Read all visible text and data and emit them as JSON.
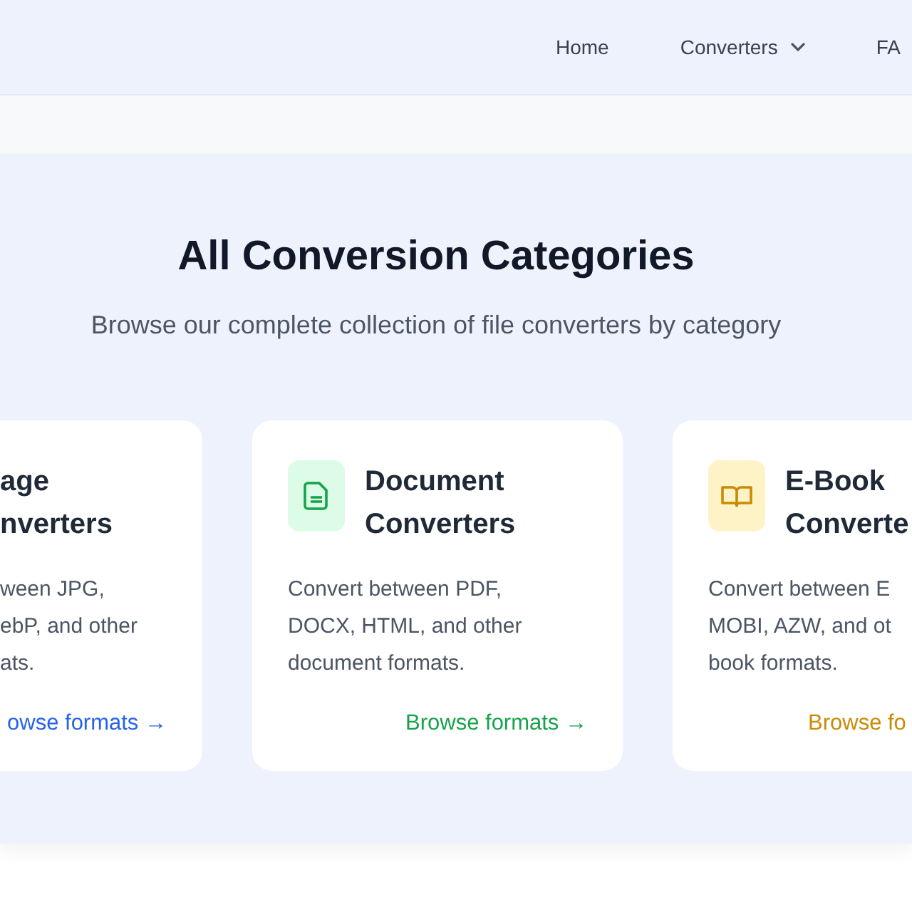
{
  "nav": {
    "items": [
      {
        "label": "Home",
        "dropdown": false
      },
      {
        "label": "Converters",
        "dropdown": true
      },
      {
        "label": "FA",
        "dropdown": false
      }
    ]
  },
  "section": {
    "title": "All Conversion Categories",
    "subtitle": "Browse our complete collection of file converters by category"
  },
  "cards": [
    {
      "title_lines": [
        "age",
        "nverters"
      ],
      "description_lines": [
        "ween JPG,",
        "ebP, and other",
        "ats."
      ],
      "link": "owse formats",
      "arrow": "→",
      "color": "#2563eb"
    },
    {
      "title_lines": [
        "Document",
        "Converters"
      ],
      "kind": "document",
      "description_lines": [
        "Convert between PDF,",
        "DOCX, HTML, and other",
        "document formats."
      ],
      "link": "Browse formats",
      "arrow": "→",
      "color": "#16a34a"
    },
    {
      "title_lines": [
        "E-Book",
        "Converte"
      ],
      "kind": "book",
      "description_lines": [
        "Convert between E",
        "MOBI, AZW, and ot",
        "book formats."
      ],
      "link": "Browse fo",
      "color": "#ca8a04"
    }
  ]
}
